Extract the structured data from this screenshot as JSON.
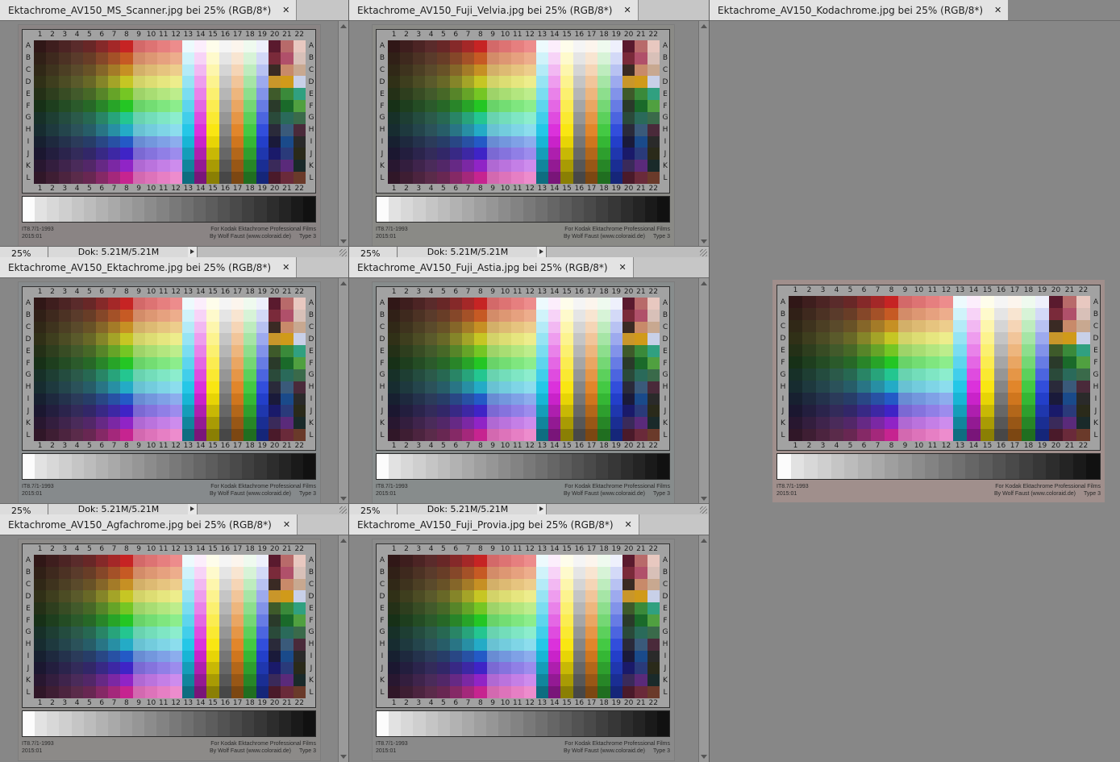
{
  "documents": [
    {
      "id": "ms_scanner",
      "title": "Ektachrome_AV150_MS_Scanner.jpg bei 25% (RGB/8*)",
      "tint": "#8a8484",
      "status": {
        "zoom": "25%",
        "doc": "Dok: 5.21M/5.21M"
      }
    },
    {
      "id": "velvia",
      "title": "Ektachrome_AV150_Fuji_Velvia.jpg bei 25% (RGB/8*)",
      "tint": "#8a8a86",
      "status": {
        "zoom": "",
        "doc": "Dok: 5.21M/5.21M"
      }
    },
    {
      "id": "kodachrome",
      "title": "Ektachrome_AV150_Kodachrome.jpg bei 25% (RGB/8*)",
      "tint": "#a08f8c"
    },
    {
      "id": "ektachrome",
      "title": "Ektachrome_AV150_Ektachrome.jpg bei 25% (RGB/8*)",
      "tint": "#868a8c",
      "status": {
        "zoom": "25%",
        "doc": "Dok: 5.21M/5.21M"
      }
    },
    {
      "id": "astia",
      "title": "Ektachrome_AV150_Fuji_Astia.jpg bei 25% (RGB/8*)",
      "tint": "#878c8c",
      "status": {
        "zoom": "25%",
        "doc": "Dok: 5.21M/5.21M"
      }
    },
    {
      "id": "agfachrome",
      "title": "Ektachrome_AV150_Agfachrome.jpg bei 25% (RGB/8*)",
      "tint": "#8c8a88"
    },
    {
      "id": "provia",
      "title": "Ektachrome_AV150_Fuji_Provia.jpg bei 25% (RGB/8*)",
      "tint": "#8a8a8a"
    }
  ],
  "velvia_zoom": "25%",
  "target": {
    "columns": [
      "1",
      "2",
      "3",
      "4",
      "5",
      "6",
      "7",
      "8",
      "9",
      "10",
      "11",
      "12",
      "13",
      "14",
      "15",
      "16",
      "17",
      "18",
      "19",
      "20",
      "21",
      "22"
    ],
    "rows": [
      "A",
      "B",
      "C",
      "D",
      "E",
      "F",
      "G",
      "H",
      "I",
      "J",
      "K",
      "L"
    ],
    "footer_left_1": "IT8.7/1-1993",
    "footer_left_2": "2015:01",
    "footer_right_1": "For Kodak Ektachrome Professional Films",
    "footer_right_2": "By Wolf Faust (www.coloraid.de)",
    "footer_type": "Type 3"
  },
  "icons": {
    "close": "close-icon"
  }
}
